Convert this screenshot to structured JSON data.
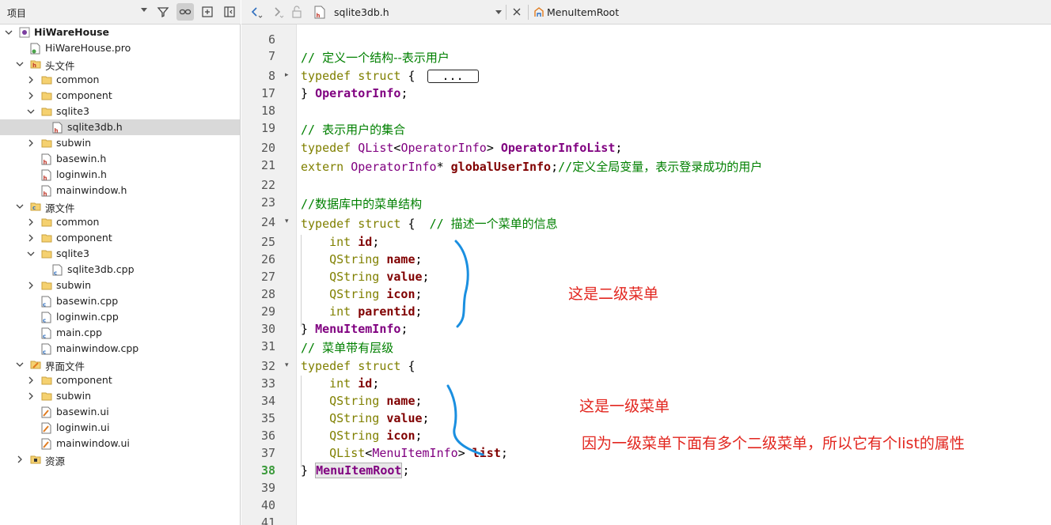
{
  "project_panel": {
    "title": "项目",
    "tree": [
      {
        "label": "HiWareHouse",
        "bold": true,
        "icon": "project-icon"
      },
      {
        "label": "HiWareHouse.pro",
        "icon": "pro-file-icon"
      },
      {
        "label": "头文件",
        "icon": "header-folder-icon"
      },
      {
        "label": "common",
        "icon": "folder-icon"
      },
      {
        "label": "component",
        "icon": "folder-icon"
      },
      {
        "label": "sqlite3",
        "icon": "folder-icon"
      },
      {
        "label": "sqlite3db.h",
        "icon": "header-file-icon"
      },
      {
        "label": "subwin",
        "icon": "folder-icon"
      },
      {
        "label": "basewin.h",
        "icon": "header-file-icon"
      },
      {
        "label": "loginwin.h",
        "icon": "header-file-icon"
      },
      {
        "label": "mainwindow.h",
        "icon": "header-file-icon"
      },
      {
        "label": "源文件",
        "icon": "source-folder-icon"
      },
      {
        "label": "common",
        "icon": "folder-icon"
      },
      {
        "label": "component",
        "icon": "folder-icon"
      },
      {
        "label": "sqlite3",
        "icon": "folder-icon"
      },
      {
        "label": "sqlite3db.cpp",
        "icon": "cpp-file-icon"
      },
      {
        "label": "subwin",
        "icon": "folder-icon"
      },
      {
        "label": "basewin.cpp",
        "icon": "cpp-file-icon"
      },
      {
        "label": "loginwin.cpp",
        "icon": "cpp-file-icon"
      },
      {
        "label": "main.cpp",
        "icon": "cpp-file-icon"
      },
      {
        "label": "mainwindow.cpp",
        "icon": "cpp-file-icon"
      },
      {
        "label": "界面文件",
        "icon": "forms-folder-icon"
      },
      {
        "label": "component",
        "icon": "folder-icon"
      },
      {
        "label": "subwin",
        "icon": "folder-icon"
      },
      {
        "label": "basewin.ui",
        "icon": "ui-file-icon"
      },
      {
        "label": "loginwin.ui",
        "icon": "ui-file-icon"
      },
      {
        "label": "mainwindow.ui",
        "icon": "ui-file-icon"
      },
      {
        "label": "资源",
        "icon": "resources-icon"
      }
    ]
  },
  "editor": {
    "file_tab": "sqlite3db.h",
    "symbol": "MenuItemRoot",
    "current_line": "38",
    "line_numbers": [
      "6",
      "7",
      "8",
      "17",
      "18",
      "19",
      "20",
      "21",
      "22",
      "23",
      "24",
      "25",
      "26",
      "27",
      "28",
      "29",
      "30",
      "31",
      "32",
      "33",
      "34",
      "35",
      "36",
      "37",
      "38",
      "39",
      "40",
      "41"
    ],
    "collapsed_placeholder": "..."
  },
  "annotations": {
    "second_level": "这是二级菜单",
    "first_level": "这是一级菜单",
    "explanation": "因为一级菜单下面有多个二级菜单，所以它有个list的属性"
  },
  "colors": {
    "annotation_red": "#e2261f",
    "annotation_blue": "#1a8fe0",
    "keyword": "#808000",
    "type": "#800080",
    "comment": "#008000",
    "member": "#800000"
  }
}
